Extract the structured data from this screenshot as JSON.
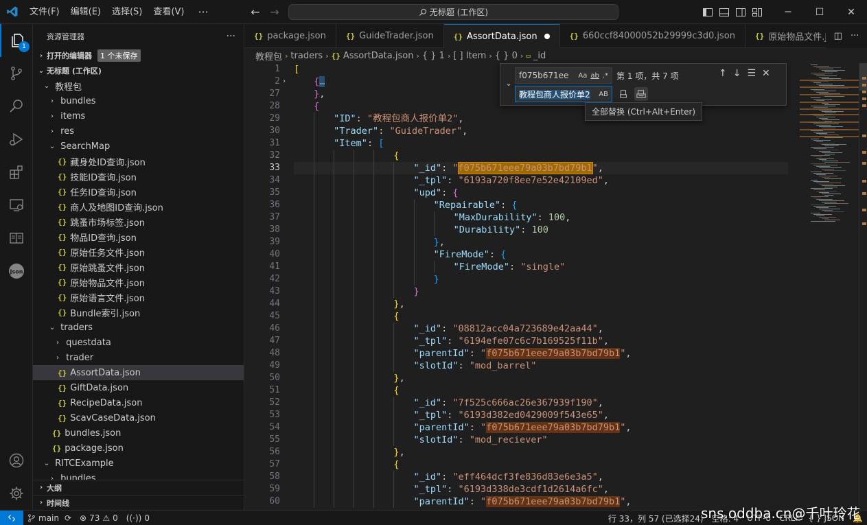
{
  "window": {
    "menu": [
      "文件(F)",
      "编辑(E)",
      "选择(S)",
      "查看(V)"
    ],
    "menu_more": "···",
    "command_center": "无标题 (工作区)"
  },
  "activitybar": {
    "explorer_badge": "1"
  },
  "sidebar": {
    "title": "资源管理器",
    "open_editors": "打开的编辑器",
    "unsaved_badge": "1 个未保存",
    "workspace": "无标题 (工作区)",
    "tree": [
      {
        "label": "教程包",
        "indent": 1,
        "type": "folder",
        "open": true
      },
      {
        "label": "bundles",
        "indent": 2,
        "type": "folder",
        "open": false
      },
      {
        "label": "items",
        "indent": 2,
        "type": "folder",
        "open": false
      },
      {
        "label": "res",
        "indent": 2,
        "type": "folder",
        "open": false
      },
      {
        "label": "SearchMap",
        "indent": 2,
        "type": "folder",
        "open": true
      },
      {
        "label": "藏身处ID查询.json",
        "indent": 3,
        "type": "json"
      },
      {
        "label": "技能ID查询.json",
        "indent": 3,
        "type": "json"
      },
      {
        "label": "任务ID查询.json",
        "indent": 3,
        "type": "json"
      },
      {
        "label": "商人及地图ID查询.json",
        "indent": 3,
        "type": "json"
      },
      {
        "label": "跳蚤市场标签.json",
        "indent": 3,
        "type": "json"
      },
      {
        "label": "物品ID查询.json",
        "indent": 3,
        "type": "json"
      },
      {
        "label": "原始任务文件.json",
        "indent": 3,
        "type": "json"
      },
      {
        "label": "原始跳蚤文件.json",
        "indent": 3,
        "type": "json"
      },
      {
        "label": "原始物品文件.json",
        "indent": 3,
        "type": "json"
      },
      {
        "label": "原始语言文件.json",
        "indent": 3,
        "type": "json"
      },
      {
        "label": "Bundle索引.json",
        "indent": 3,
        "type": "json"
      },
      {
        "label": "traders",
        "indent": 2,
        "type": "folder",
        "open": true
      },
      {
        "label": "questdata",
        "indent": 3,
        "type": "folder",
        "open": false
      },
      {
        "label": "trader",
        "indent": 3,
        "type": "folder",
        "open": false
      },
      {
        "label": "AssortData.json",
        "indent": 3,
        "type": "json",
        "selected": true
      },
      {
        "label": "GiftData.json",
        "indent": 3,
        "type": "json"
      },
      {
        "label": "RecipeData.json",
        "indent": 3,
        "type": "json"
      },
      {
        "label": "ScavCaseData.json",
        "indent": 3,
        "type": "json"
      },
      {
        "label": "bundles.json",
        "indent": 2,
        "type": "json"
      },
      {
        "label": "package.json",
        "indent": 2,
        "type": "json"
      },
      {
        "label": "RITCExample",
        "indent": 1,
        "type": "folder",
        "open": true
      },
      {
        "label": "bundles",
        "indent": 2,
        "type": "folder",
        "open": false
      }
    ],
    "outline": "大纲",
    "timeline": "时间线"
  },
  "tabs": [
    {
      "label": "package.json",
      "active": false
    },
    {
      "label": "GuideTrader.json",
      "active": false
    },
    {
      "label": "AssortData.json",
      "active": true,
      "dirty": true
    },
    {
      "label": "660ccf84000052b29999c3d0.json",
      "active": false
    },
    {
      "label": "原始物品文件.json",
      "active": false
    }
  ],
  "breadcrumb": [
    "教程包",
    "traders",
    "AssortData.json",
    "{ } 1",
    "[ ] Item",
    "{ } 0",
    "_id"
  ],
  "find": {
    "search_value": "f075b671ee",
    "replace_value": "教程包商人报价单2",
    "opt_case": "Aa",
    "opt_word": "ab",
    "opt_regex": ".*",
    "opt_preserve": "AB",
    "result": "第 1 项，共 7 项",
    "tooltip": "全部替换 (Ctrl+Alt+Enter)"
  },
  "editor": {
    "current_line": 33,
    "lines": [
      {
        "n": 1,
        "indent": 0,
        "t": [
          [
            "b1",
            "["
          ]
        ]
      },
      {
        "n": 2,
        "indent": 1,
        "fold": true,
        "folded": true,
        "t": [
          [
            "b2",
            "{"
          ],
          [
            "folded",
            "…"
          ]
        ]
      },
      {
        "n": 27,
        "indent": 1,
        "t": [
          [
            "b2",
            "}"
          ],
          [
            "p",
            ","
          ]
        ]
      },
      {
        "n": 28,
        "indent": 1,
        "fold": true,
        "t": [
          [
            "b2",
            "{"
          ]
        ]
      },
      {
        "n": 29,
        "indent": 2,
        "t": [
          [
            "k",
            "\"ID\""
          ],
          [
            "p",
            ": "
          ],
          [
            "s",
            "\"教程包商人报价单2\""
          ],
          [
            "p",
            ","
          ]
        ]
      },
      {
        "n": 30,
        "indent": 2,
        "t": [
          [
            "k",
            "\"Trader\""
          ],
          [
            "p",
            ": "
          ],
          [
            "s",
            "\"GuideTrader\""
          ],
          [
            "p",
            ","
          ]
        ]
      },
      {
        "n": 31,
        "indent": 2,
        "fold": true,
        "t": [
          [
            "k",
            "\"Item\""
          ],
          [
            "p",
            ": "
          ],
          [
            "b3",
            "["
          ]
        ]
      },
      {
        "n": 32,
        "indent": 5,
        "fold": true,
        "t": [
          [
            "b1",
            "{"
          ]
        ]
      },
      {
        "n": 33,
        "indent": 6,
        "t": [
          [
            "k",
            "\"_id\""
          ],
          [
            "p",
            ": "
          ],
          [
            "s",
            "\""
          ],
          [
            "hlcur",
            "f075b671eee79a03b7bd79b1"
          ],
          [
            "s",
            "\""
          ],
          [
            "p",
            ","
          ]
        ]
      },
      {
        "n": 34,
        "indent": 6,
        "t": [
          [
            "k",
            "\"_tpl\""
          ],
          [
            "p",
            ": "
          ],
          [
            "s",
            "\"6193a720f8ee7e52e42109ed\""
          ],
          [
            "p",
            ","
          ]
        ]
      },
      {
        "n": 35,
        "indent": 6,
        "fold": true,
        "t": [
          [
            "k",
            "\"upd\""
          ],
          [
            "p",
            ": "
          ],
          [
            "b2",
            "{"
          ]
        ]
      },
      {
        "n": 36,
        "indent": 7,
        "fold": true,
        "t": [
          [
            "k",
            "\"Repairable\""
          ],
          [
            "p",
            ": "
          ],
          [
            "b3",
            "{"
          ]
        ]
      },
      {
        "n": 37,
        "indent": 8,
        "t": [
          [
            "k",
            "\"MaxDurability\""
          ],
          [
            "p",
            ": "
          ],
          [
            "n",
            "100"
          ],
          [
            "p",
            ","
          ]
        ]
      },
      {
        "n": 38,
        "indent": 8,
        "t": [
          [
            "k",
            "\"Durability\""
          ],
          [
            "p",
            ": "
          ],
          [
            "n",
            "100"
          ]
        ]
      },
      {
        "n": 39,
        "indent": 7,
        "t": [
          [
            "b3",
            "}"
          ],
          [
            "p",
            ","
          ]
        ]
      },
      {
        "n": 40,
        "indent": 7,
        "fold": true,
        "t": [
          [
            "k",
            "\"FireMode\""
          ],
          [
            "p",
            ": "
          ],
          [
            "b3",
            "{"
          ]
        ]
      },
      {
        "n": 41,
        "indent": 8,
        "t": [
          [
            "k",
            "\"FireMode\""
          ],
          [
            "p",
            ": "
          ],
          [
            "s",
            "\"single\""
          ]
        ]
      },
      {
        "n": 42,
        "indent": 7,
        "t": [
          [
            "b3",
            "}"
          ]
        ]
      },
      {
        "n": 43,
        "indent": 6,
        "t": [
          [
            "b2",
            "}"
          ]
        ]
      },
      {
        "n": 44,
        "indent": 5,
        "t": [
          [
            "b1",
            "}"
          ],
          [
            "p",
            ","
          ]
        ]
      },
      {
        "n": 45,
        "indent": 5,
        "fold": true,
        "t": [
          [
            "b1",
            "{"
          ]
        ]
      },
      {
        "n": 46,
        "indent": 6,
        "t": [
          [
            "k",
            "\"_id\""
          ],
          [
            "p",
            ": "
          ],
          [
            "s",
            "\"08812acc04a723689e42aa44\""
          ],
          [
            "p",
            ","
          ]
        ]
      },
      {
        "n": 47,
        "indent": 6,
        "t": [
          [
            "k",
            "\"_tpl\""
          ],
          [
            "p",
            ": "
          ],
          [
            "s",
            "\"6194efe07c6c7b169525f11b\""
          ],
          [
            "p",
            ","
          ]
        ]
      },
      {
        "n": 48,
        "indent": 6,
        "t": [
          [
            "k",
            "\"parentId\""
          ],
          [
            "p",
            ": "
          ],
          [
            "s",
            "\""
          ],
          [
            "hl",
            "f075b671eee79a03b7bd79b1"
          ],
          [
            "s",
            "\""
          ],
          [
            "p",
            ","
          ]
        ]
      },
      {
        "n": 49,
        "indent": 6,
        "t": [
          [
            "k",
            "\"slotId\""
          ],
          [
            "p",
            ": "
          ],
          [
            "s",
            "\"mod_barrel\""
          ]
        ]
      },
      {
        "n": 50,
        "indent": 5,
        "t": [
          [
            "b1",
            "}"
          ],
          [
            "p",
            ","
          ]
        ]
      },
      {
        "n": 51,
        "indent": 5,
        "fold": true,
        "t": [
          [
            "b1",
            "{"
          ]
        ]
      },
      {
        "n": 52,
        "indent": 6,
        "t": [
          [
            "k",
            "\"_id\""
          ],
          [
            "p",
            ": "
          ],
          [
            "s",
            "\"7f525c666ac26e367939f190\""
          ],
          [
            "p",
            ","
          ]
        ]
      },
      {
        "n": 53,
        "indent": 6,
        "t": [
          [
            "k",
            "\"_tpl\""
          ],
          [
            "p",
            ": "
          ],
          [
            "s",
            "\"6193d382ed0429009f543e65\""
          ],
          [
            "p",
            ","
          ]
        ]
      },
      {
        "n": 54,
        "indent": 6,
        "t": [
          [
            "k",
            "\"parentId\""
          ],
          [
            "p",
            ": "
          ],
          [
            "s",
            "\""
          ],
          [
            "hl",
            "f075b671eee79a03b7bd79b1"
          ],
          [
            "s",
            "\""
          ],
          [
            "p",
            ","
          ]
        ]
      },
      {
        "n": 55,
        "indent": 6,
        "t": [
          [
            "k",
            "\"slotId\""
          ],
          [
            "p",
            ": "
          ],
          [
            "s",
            "\"mod_reciever\""
          ]
        ]
      },
      {
        "n": 56,
        "indent": 5,
        "t": [
          [
            "b1",
            "}"
          ],
          [
            "p",
            ","
          ]
        ]
      },
      {
        "n": 57,
        "indent": 5,
        "fold": true,
        "t": [
          [
            "b1",
            "{"
          ]
        ]
      },
      {
        "n": 58,
        "indent": 6,
        "t": [
          [
            "k",
            "\"_id\""
          ],
          [
            "p",
            ": "
          ],
          [
            "s",
            "\"eff464dcf3fe836d83e6e3a5\""
          ],
          [
            "p",
            ","
          ]
        ]
      },
      {
        "n": 59,
        "indent": 6,
        "t": [
          [
            "k",
            "\"_tpl\""
          ],
          [
            "p",
            ": "
          ],
          [
            "s",
            "\"6193d338de3cdf1d2614a6fc\""
          ],
          [
            "p",
            ","
          ]
        ]
      },
      {
        "n": 60,
        "indent": 6,
        "t": [
          [
            "k",
            "\"parentId\""
          ],
          [
            "p",
            ": "
          ],
          [
            "s",
            "\""
          ],
          [
            "hl",
            "f075b671eee79a03b7bd79b1"
          ],
          [
            "s",
            "\""
          ],
          [
            "p",
            ","
          ]
        ]
      }
    ]
  },
  "statusbar": {
    "branch": "main",
    "errors": "73",
    "warnings": "0",
    "ports": "0",
    "position": "行 33，列 57 (已选择24)",
    "spaces": "空格: 4",
    "encoding": "UTF-8",
    "eol": "CRLF",
    "language": "JSON"
  },
  "watermark": "sns.oddba.cn@千叶玲花",
  "colors": {
    "accent": "#0078d4",
    "match": "#623315",
    "current_match": "#9e6a03"
  }
}
